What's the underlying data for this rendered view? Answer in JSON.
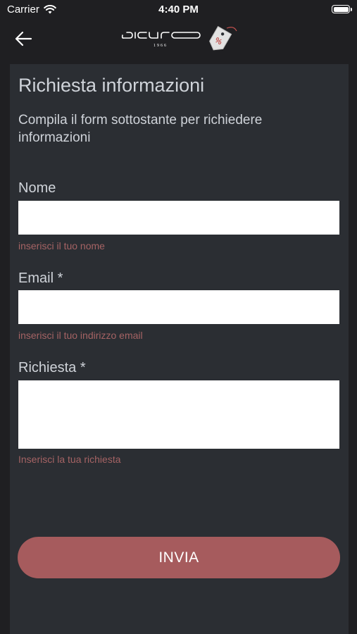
{
  "status_bar": {
    "carrier": "Carrier",
    "time": "4:40 PM"
  },
  "nav": {
    "logo": {
      "text": "sicuro",
      "year": "1966",
      "icon": "price-tag-icon"
    }
  },
  "form": {
    "title": "Richiesta informazioni",
    "subtitle": "Compila il form sottostante per richiedere informazioni",
    "fields": [
      {
        "label": "Nome",
        "value": "",
        "hint": "inserisci il tuo nome"
      },
      {
        "label": "Email *",
        "value": "",
        "hint": "inserisci il tuo indirizzo email"
      },
      {
        "label": "Richiesta *",
        "value": "",
        "hint": "Inserisci la tua richiesta"
      }
    ],
    "submit_label": "INVIA"
  },
  "colors": {
    "background": "#1f1f22",
    "card": "#2b2e33",
    "text": "#cfd3d9",
    "hint": "#a56364",
    "accent": "#a65b5d"
  }
}
